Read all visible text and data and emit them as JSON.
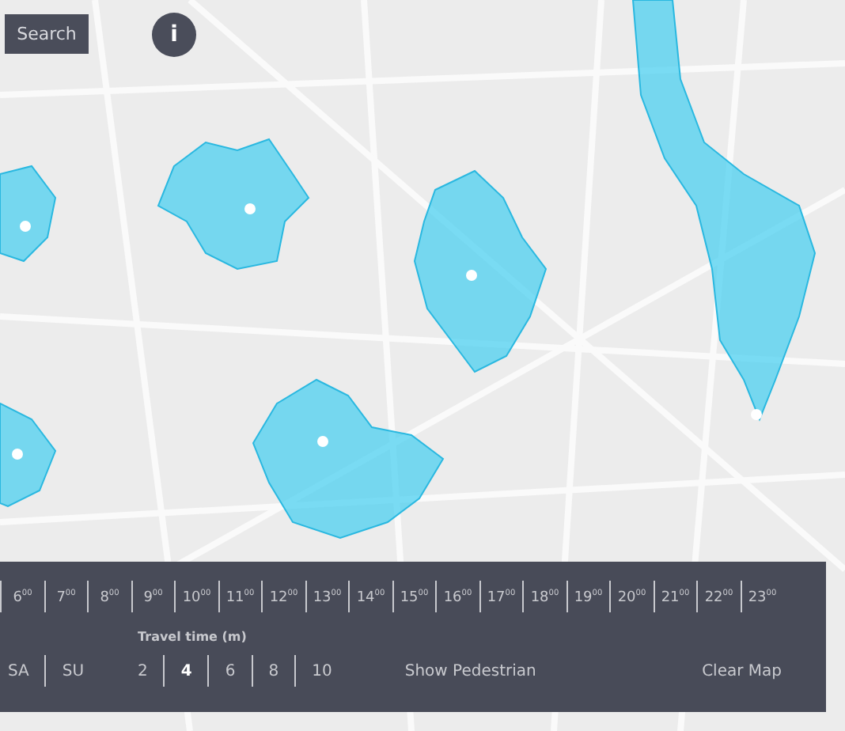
{
  "search_button": {
    "label": "Search"
  },
  "info_button": {
    "label": "i"
  },
  "hours": [
    {
      "label": "6$^{00}$",
      "selected": false
    },
    {
      "label": "7$^{00}$",
      "selected": false
    },
    {
      "label": "8$^{00}$",
      "selected": false
    },
    {
      "label": "9$^{00}$",
      "selected": false
    },
    {
      "label": "10$^{00}$",
      "selected": false
    },
    {
      "label": "11$^{00}$",
      "selected": false
    },
    {
      "label": "12$^{00}$",
      "selected": false
    },
    {
      "label": "13$^{00}$",
      "selected": false
    },
    {
      "label": "14$^{00}$",
      "selected": false
    },
    {
      "label": "15$^{00}$",
      "selected": false
    },
    {
      "label": "16$^{00}$",
      "selected": false
    },
    {
      "label": "17$^{00}$",
      "selected": false
    },
    {
      "label": "18$^{00}$",
      "selected": false
    },
    {
      "label": "19$^{00}$",
      "selected": false
    },
    {
      "label": "20$^{00}$",
      "selected": false
    },
    {
      "label": "21$^{00}$",
      "selected": false
    },
    {
      "label": "22$^{00}$",
      "selected": false
    },
    {
      "label": "23$^{00}$",
      "selected": false
    }
  ],
  "days": [
    {
      "label": "SA",
      "selected": false
    },
    {
      "label": "SU",
      "selected": false
    }
  ],
  "travel_time": {
    "title": "Travel time (m)",
    "options": [
      {
        "label": "2",
        "selected": false
      },
      {
        "label": "4",
        "selected": true
      },
      {
        "label": "6",
        "selected": false
      },
      {
        "label": "8",
        "selected": false
      },
      {
        "label": "10",
        "selected": false
      }
    ]
  },
  "show_pedestrian": "Show Pedestrian",
  "clear_map": "Clear Map"
}
